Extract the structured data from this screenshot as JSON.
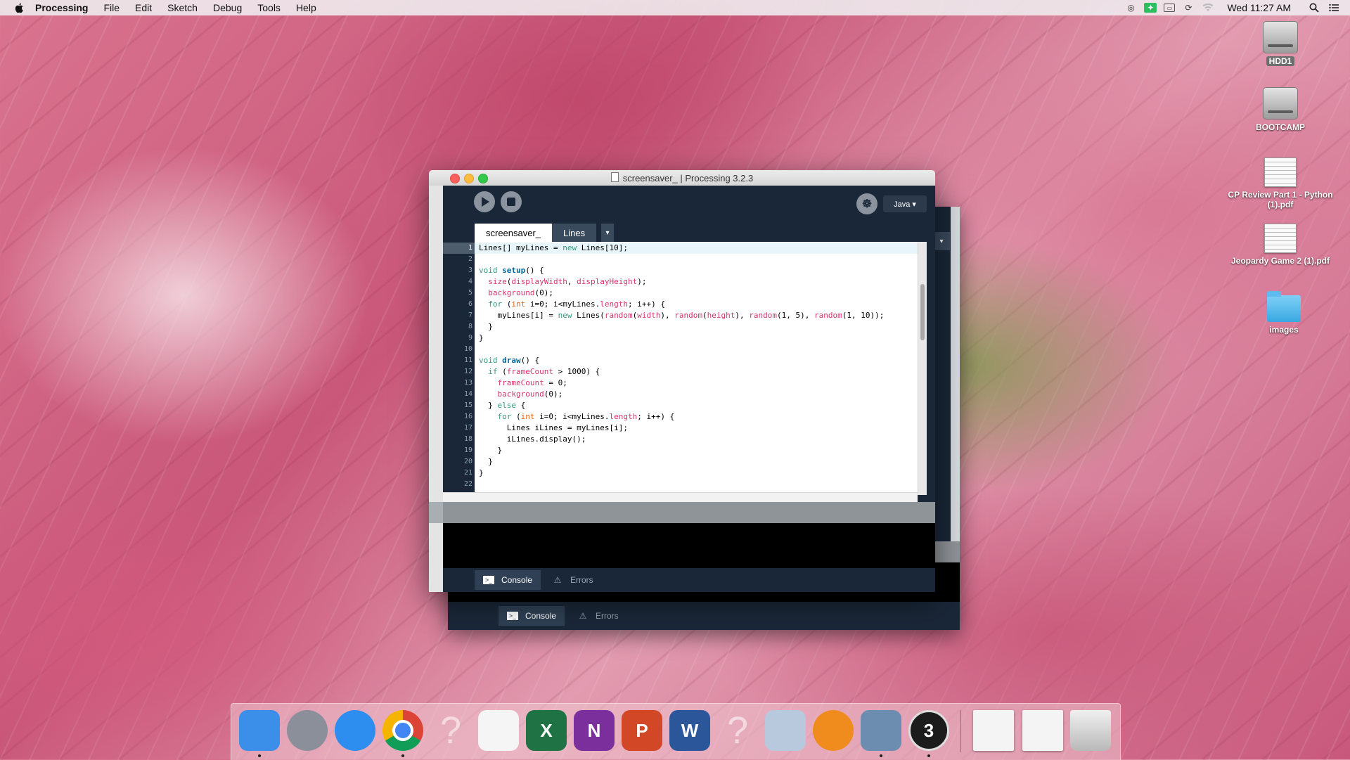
{
  "menubar": {
    "app_name": "Processing",
    "items": [
      "File",
      "Edit",
      "Sketch",
      "Debug",
      "Tools",
      "Help"
    ],
    "clock": "Wed 11:27 AM"
  },
  "desktop_icons": [
    {
      "label": "HDD1",
      "kind": "drive"
    },
    {
      "label": "BOOTCAMP",
      "kind": "drive"
    },
    {
      "label": "CP Review Part 1 - Python (1).pdf",
      "kind": "pdf"
    },
    {
      "label": "Jeopardy Game 2 (1).pdf",
      "kind": "pdf"
    },
    {
      "label": "images",
      "kind": "folder"
    }
  ],
  "window": {
    "title": "screensaver_ | Processing 3.2.3",
    "mode": "Java ▾",
    "tabs": [
      "screensaver_",
      "Lines"
    ],
    "tab_menu": "▾",
    "console_tab": "Console",
    "errors_tab": "Errors",
    "current_line": 1
  },
  "back_window": {
    "console_tab": "Console",
    "errors_tab": "Errors"
  },
  "code_lines": [
    "Lines[] myLines = new Lines[10];",
    "",
    "void setup() {",
    "  size(displayWidth, displayHeight);",
    "  background(0);",
    "  for (int i=0; i<myLines.length; i++) {",
    "    myLines[i] = new Lines(random(width), random(height), random(1, 5), random(1, 10));",
    "  }",
    "}",
    "",
    "void draw() {",
    "  if (frameCount > 1000) {",
    "    frameCount = 0;",
    "    background(0);",
    "  } else {",
    "    for (int i=0; i<myLines.length; i++) {",
    "      Lines iLines = myLines[i];",
    "      iLines.display();",
    "    }",
    "  }",
    "}",
    ""
  ],
  "dock_apps": [
    {
      "name": "Finder",
      "icon": "finder-icon",
      "color": "#3b8fe8",
      "running": true
    },
    {
      "name": "Launchpad",
      "icon": "rocket-icon",
      "color": "#8a8f99",
      "running": false
    },
    {
      "name": "Safari",
      "icon": "compass-icon",
      "color": "#2d8ef0",
      "running": false
    },
    {
      "name": "Chrome",
      "icon": "chrome-icon",
      "color": "#e0e0e0",
      "running": true
    },
    {
      "name": "Unknown",
      "icon": "question-icon",
      "color": "transparent",
      "running": false
    },
    {
      "name": "Photos",
      "icon": "photos-icon",
      "color": "#f5f5f5",
      "running": false
    },
    {
      "name": "Excel",
      "icon": "excel-icon",
      "color": "#1f7244",
      "running": false
    },
    {
      "name": "OneNote",
      "icon": "onenote-icon",
      "color": "#7b2f9c",
      "running": false
    },
    {
      "name": "PowerPoint",
      "icon": "powerpoint-icon",
      "color": "#d24726",
      "running": false
    },
    {
      "name": "Word",
      "icon": "word-icon",
      "color": "#2b579a",
      "running": false
    },
    {
      "name": "Unknown",
      "icon": "question-icon",
      "color": "transparent",
      "running": false
    },
    {
      "name": "Preview",
      "icon": "preview-icon",
      "color": "#b8c9dd",
      "running": false
    },
    {
      "name": "iBooks",
      "icon": "ibooks-icon",
      "color": "#f08c1e",
      "running": false
    },
    {
      "name": "Image Capture",
      "icon": "image-capture-icon",
      "color": "#6d8db0",
      "running": true
    },
    {
      "name": "Processing",
      "icon": "processing-icon",
      "color": "#1c1c1c",
      "running": true
    }
  ],
  "dock_letters": {
    "excel": "X",
    "onenote": "N",
    "powerpoint": "P",
    "word": "W",
    "processing": "3"
  }
}
